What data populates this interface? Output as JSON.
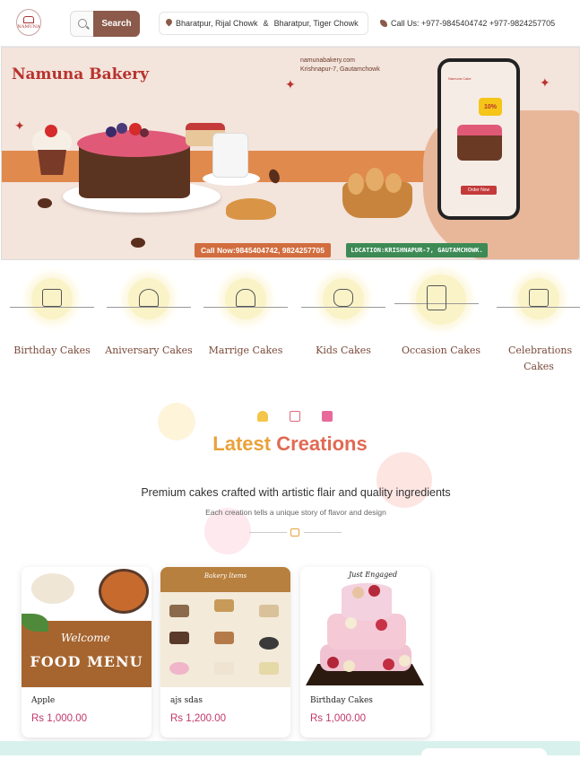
{
  "header": {
    "logo_text": "NAMUNA",
    "search_placeholder": "",
    "search_button": "Search",
    "location_1": "Bharatpur, Rijal Chowk",
    "location_sep": "&",
    "location_2": "Bharatpur, Tiger Chowk",
    "call_label": "Call Us: +977-9845404742 +977-9824257705"
  },
  "banner": {
    "brand": "Namuna Bakery",
    "website": "namunabakery.com",
    "address": "Krishnapur-7, Gautamchowk",
    "call_now": "Call Now:9845404742, 9824257705",
    "location": "LOCATION:KRISHNAPUR-7, GAUTAMCHOWK.",
    "discount": "10%",
    "order_now": "Order Now",
    "screen_title": "Namuna Cake"
  },
  "categories": [
    {
      "label": "Birthday Cakes",
      "icon": "birthday-cake-icon"
    },
    {
      "label": "Aniversary Cakes",
      "icon": "champagne-glasses-icon"
    },
    {
      "label": "Marrige Cakes",
      "icon": "wedding-couple-icon"
    },
    {
      "label": "Kids Cakes",
      "icon": "rocking-horse-icon"
    },
    {
      "label": "Occasion Cakes",
      "icon": "tiered-cake-icon"
    },
    {
      "label": "Celebrations Cakes",
      "icon": "gift-box-icon"
    }
  ],
  "section": {
    "title_part1": "Latest",
    "title_part2": "Creations",
    "subtitle": "Premium cakes crafted with artistic flair and quality ingredients",
    "caption": "Each creation tells a unique story of flavor and design",
    "icons": [
      "cupcake-icon",
      "cake-icon",
      "gift-icon"
    ]
  },
  "products": [
    {
      "name": "Apple",
      "price": "Rs 1,000.00",
      "image_text": "FOOD MENU",
      "image_script": "Welcome"
    },
    {
      "name": "ajs sdas",
      "price": "Rs 1,200.00",
      "image_text": "Bakery Items"
    },
    {
      "name": "Birthday Cakes",
      "price": "Rs 1,000.00",
      "image_text": "Just Engaged"
    }
  ],
  "colors": {
    "brand_brown": "#8b5a4a",
    "accent_orange": "#e9a23b",
    "accent_coral": "#e06a54",
    "price_pink": "#c0396b",
    "banner_stripe": "#e08a4e"
  }
}
